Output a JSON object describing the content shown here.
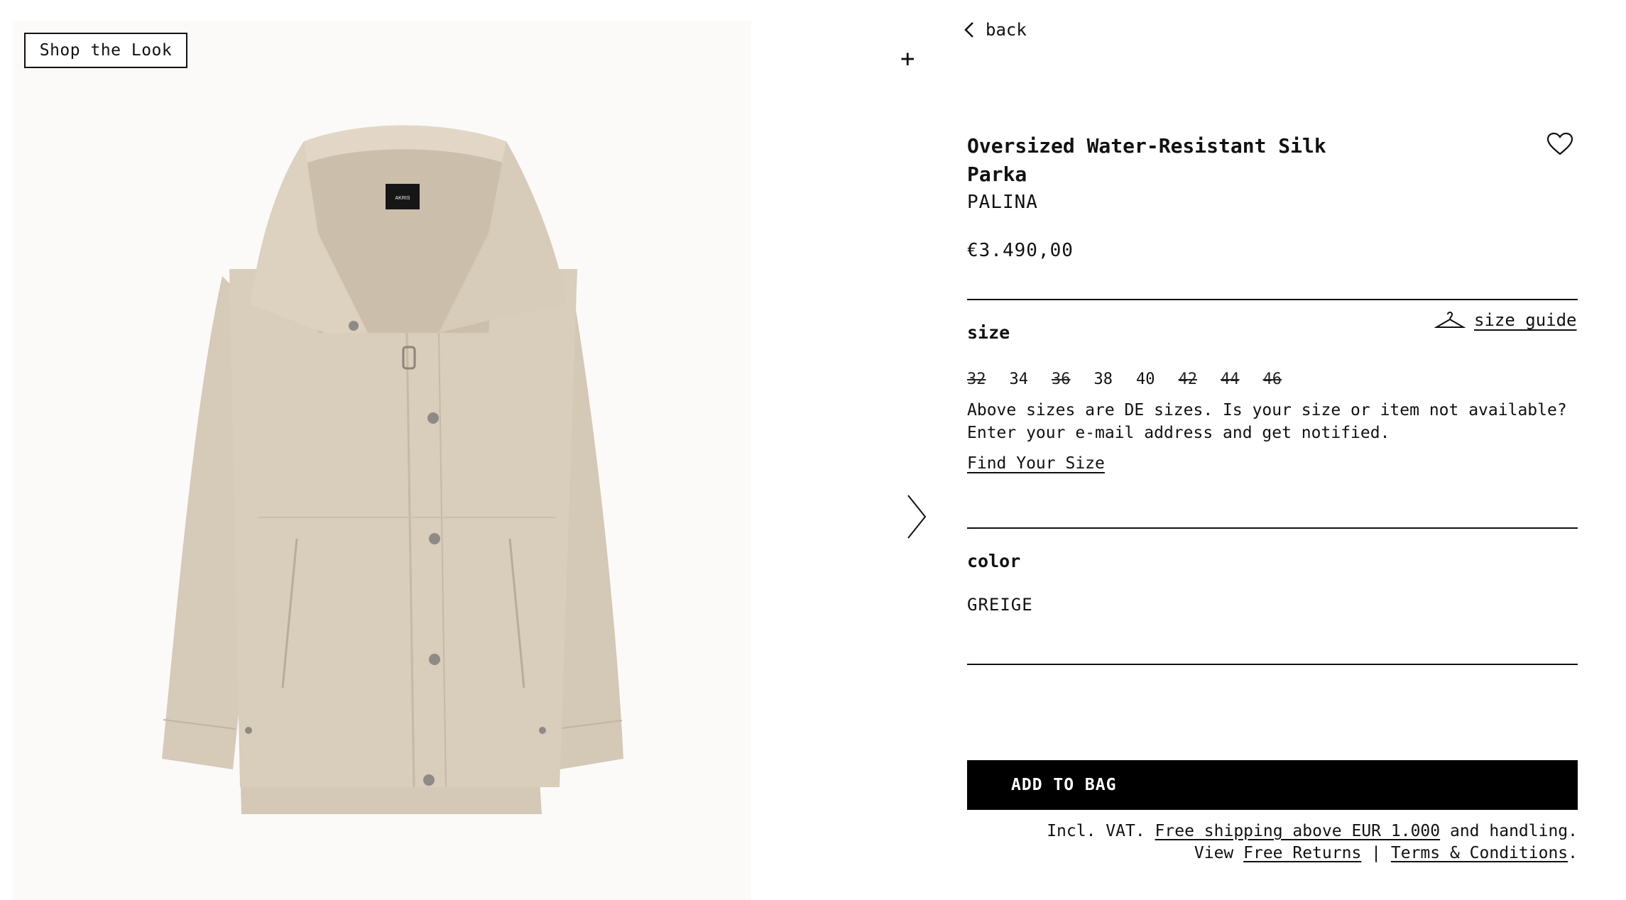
{
  "gallery": {
    "shop_the_look_label": "Shop the Look",
    "image_alt": "Beige oversized water-resistant silk parka",
    "brand_label_text": "AKRIS",
    "add_icon": "plus-icon",
    "next_icon": "chevron-right-icon"
  },
  "nav": {
    "back_label": "back",
    "back_icon": "chevron-left-icon"
  },
  "product": {
    "title": "Oversized Water-Resistant Silk Parka",
    "style_name": "PALINA",
    "price": "€3.490,00",
    "wishlist_icon": "heart-icon"
  },
  "size": {
    "label": "size",
    "guide_label": "size guide",
    "guide_icon": "hanger-icon",
    "options": [
      {
        "label": "32",
        "available": false
      },
      {
        "label": "34",
        "available": true
      },
      {
        "label": "36",
        "available": false
      },
      {
        "label": "38",
        "available": true
      },
      {
        "label": "40",
        "available": true
      },
      {
        "label": "42",
        "available": false
      },
      {
        "label": "44",
        "available": false
      },
      {
        "label": "46",
        "available": false
      }
    ],
    "note": "Above sizes are DE sizes. Is your size or item not available? Enter your e-mail address and get notified.",
    "find_size_label": "Find Your Size"
  },
  "color": {
    "label": "color",
    "value": "GREIGE"
  },
  "cart": {
    "add_to_bag_label": "ADD TO BAG"
  },
  "footnote": {
    "vat_prefix": "Incl. VAT.",
    "shipping_link": "Free shipping above EUR 1.000",
    "handling_suffix": "and handling.",
    "view_prefix": "View",
    "returns_link": "Free Returns",
    "separator": "|",
    "terms_link": "Terms & Conditions",
    "period": "."
  },
  "colors": {
    "jacket": "#d9cdbb",
    "gallery_bg": "#fbfaf9",
    "button_bg": "#000000",
    "text": "#111111"
  }
}
